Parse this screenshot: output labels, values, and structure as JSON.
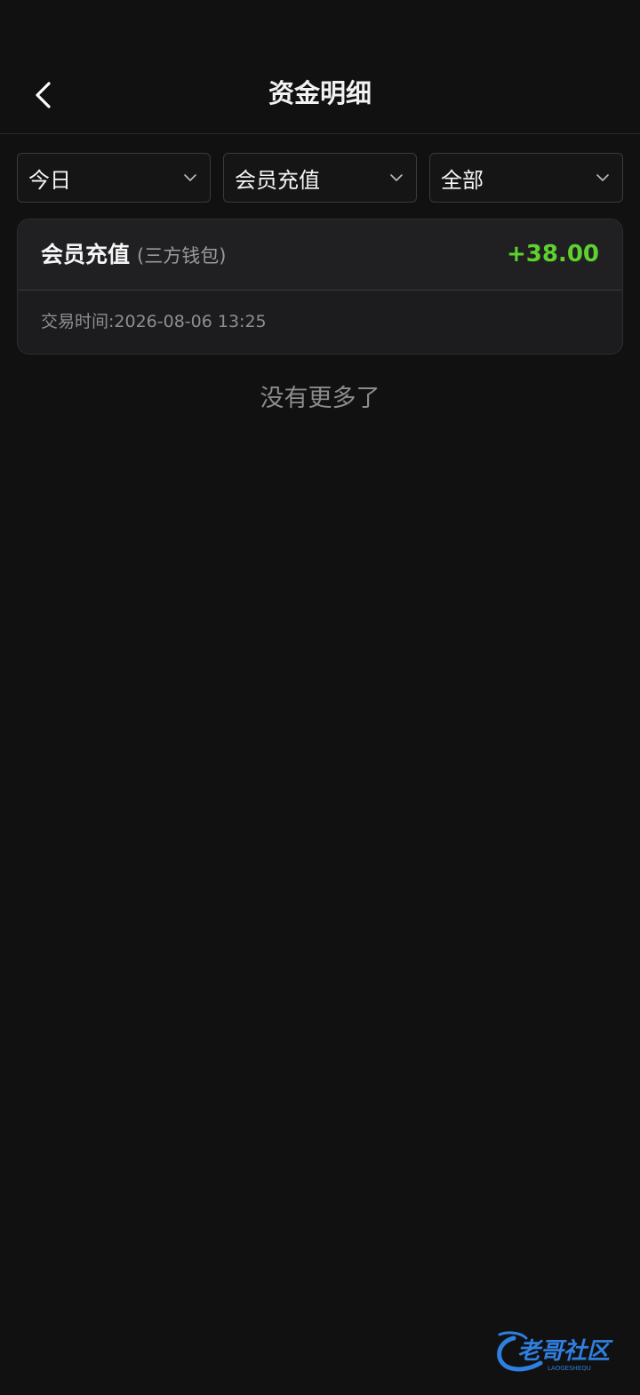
{
  "header": {
    "title": "资金明细",
    "back_icon": "chevron-left-icon"
  },
  "filters": [
    {
      "label": "今日"
    },
    {
      "label": "会员充值"
    },
    {
      "label": "全部"
    }
  ],
  "record": {
    "title": "会员充值",
    "subtitle": "(三方钱包)",
    "amount": "+38.00",
    "time": "交易时间:2026-08-06 13:25",
    "amount_color": "#5fd12e"
  },
  "list": {
    "end_text": "没有更多了"
  },
  "watermark": {
    "text": "老哥社区",
    "subtext": "LAOGESHEQU"
  }
}
